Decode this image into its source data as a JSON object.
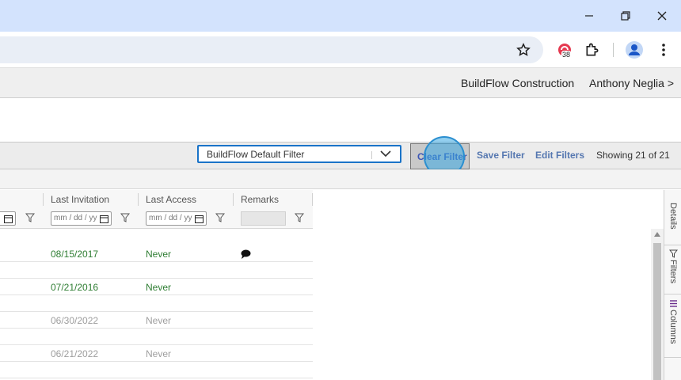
{
  "browser": {
    "window_controls": {
      "minimize": "—",
      "restore": "❐",
      "close": "✕"
    },
    "extension_badge_count": "38",
    "icons": [
      "bookmark-star-icon",
      "extension-icon",
      "puzzle-icon",
      "profile-icon",
      "more-vert-icon"
    ]
  },
  "header": {
    "company": "BuildFlow Construction",
    "user": "Anthony Neglia >"
  },
  "filterbar": {
    "selected_filter": "BuildFlow Default Filter",
    "clear_label": "Clear Filter",
    "save_label": "Save Filter",
    "edit_label": "Edit Filters",
    "showing": "Showing 21 of 21"
  },
  "grid": {
    "columns": [
      {
        "title": "Last Invitation",
        "placeholder": "mm/dd/yyyy"
      },
      {
        "title": "Last Access",
        "placeholder": "mm/dd/yyyy"
      },
      {
        "title": "Remarks"
      }
    ],
    "partial_placeholder": "mm / dd / yy",
    "rows": [
      {
        "invitation": "08/15/2017",
        "access": "Never",
        "remark_icon": true,
        "status": "active"
      },
      {
        "invitation": "",
        "access": "",
        "remark_icon": false,
        "status": "active"
      },
      {
        "invitation": "07/21/2016",
        "access": "Never",
        "remark_icon": false,
        "status": "active"
      },
      {
        "invitation": "",
        "access": "",
        "remark_icon": false,
        "status": "active"
      },
      {
        "invitation": "06/30/2022",
        "access": "Never",
        "remark_icon": false,
        "status": "inactive"
      },
      {
        "invitation": "",
        "access": "",
        "remark_icon": false,
        "status": "inactive"
      },
      {
        "invitation": "06/21/2022",
        "access": "Never",
        "remark_icon": false,
        "status": "inactive"
      }
    ]
  },
  "side_panel": {
    "tabs": [
      "Details",
      "Filters",
      "Columns"
    ]
  },
  "colors": {
    "active_text": "#2e7d32",
    "inactive_text": "#9e9e9e",
    "link": "#5577b0",
    "chrome_frame": "#d3e3fd"
  }
}
